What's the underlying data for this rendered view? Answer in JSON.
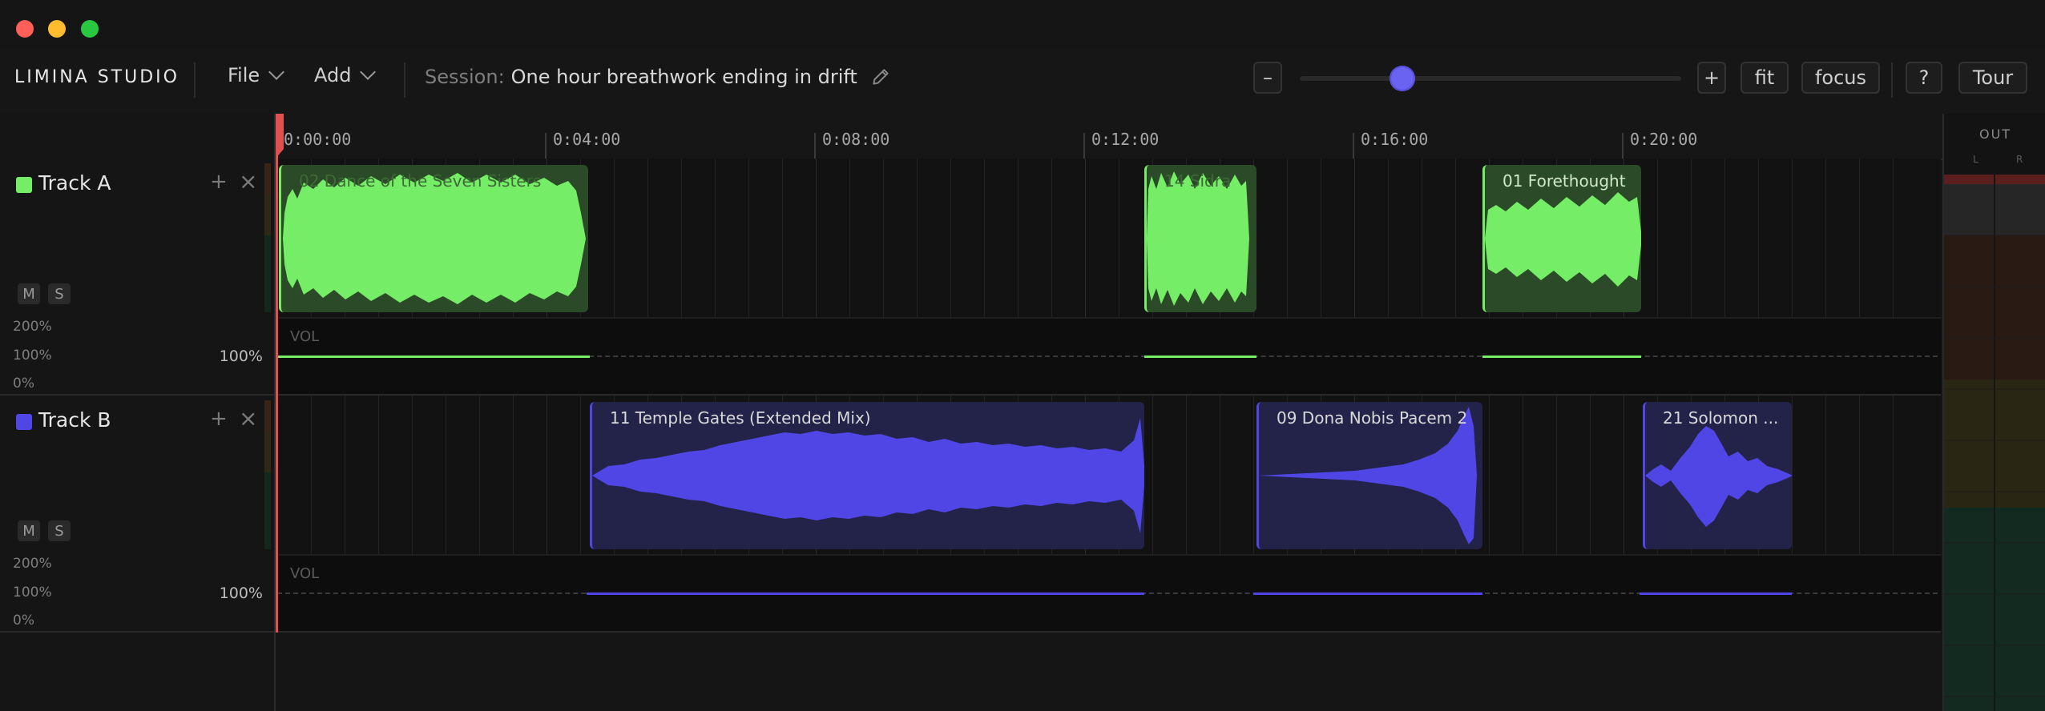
{
  "app": {
    "title": "LIMINA STUDIO"
  },
  "menus": {
    "file": "File",
    "add": "Add"
  },
  "session": {
    "label": "Session:",
    "name": "One hour breathwork ending in drift"
  },
  "zoom": {
    "minus": "–",
    "plus": "+",
    "fit": "fit",
    "focus": "focus",
    "level": 0.27
  },
  "help": {
    "question": "?",
    "tour": "Tour"
  },
  "ruler": {
    "ticks": [
      "0:00:00",
      "0:04:00",
      "0:08:00",
      "0:12:00",
      "0:16:00",
      "0:20:00"
    ]
  },
  "tracks": [
    {
      "name": "Track A",
      "color": "#76ed66",
      "mute": "M",
      "solo": "S",
      "scale": [
        "200%",
        "100%",
        "0%"
      ],
      "volume": "100%",
      "vol_label": "VOL",
      "clips": [
        {
          "name": "02 Dance of the Seven Sisters"
        },
        {
          "name": "14 Sidra"
        },
        {
          "name": "01 Forethought"
        }
      ]
    },
    {
      "name": "Track B",
      "color": "#4f46e5",
      "mute": "M",
      "solo": "S",
      "scale": [
        "200%",
        "100%",
        "0%"
      ],
      "volume": "100%",
      "vol_label": "VOL",
      "clips": [
        {
          "name": "11 Temple Gates (Extended Mix)"
        },
        {
          "name": "09 Dona Nobis Pacem 2"
        },
        {
          "name": "21 Solomon ..."
        }
      ]
    }
  ],
  "output": {
    "label": "OUT",
    "left": "L",
    "right": "R"
  },
  "icons": {
    "edit": "pencil-icon",
    "add": "plus-icon",
    "remove": "close-icon",
    "menu": "chevron-down-icon"
  }
}
